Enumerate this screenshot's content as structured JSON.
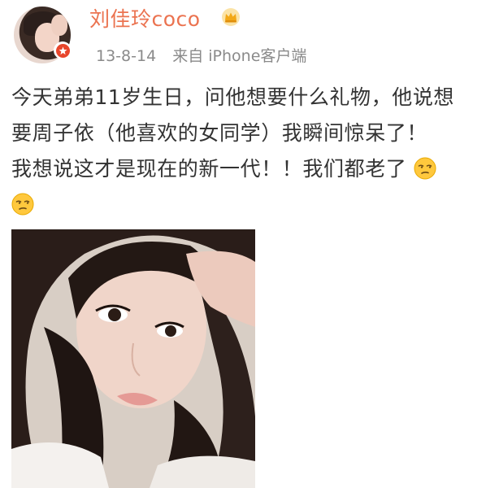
{
  "post": {
    "username": "刘佳玲coco",
    "date": "13-8-14",
    "source": "来自 iPhone客户端",
    "text_lines": [
      "今天弟弟11岁生日，问他想要什么礼物，他说想",
      "要周子依（他喜欢的女同学）我瞬间惊呆了！",
      "我想说这才是现在的新一代！！我们都老了"
    ],
    "icons": {
      "avatar_badge": "verified-badge-icon",
      "crown": "crown-icon",
      "emoji": "unamused-face-emoji"
    }
  },
  "colors": {
    "username": "#eb7350",
    "meta": "#8a8a8a",
    "text": "#333333",
    "badge": "#e8462c",
    "crown": "#f2a817",
    "emoji": "#ffc83d"
  }
}
